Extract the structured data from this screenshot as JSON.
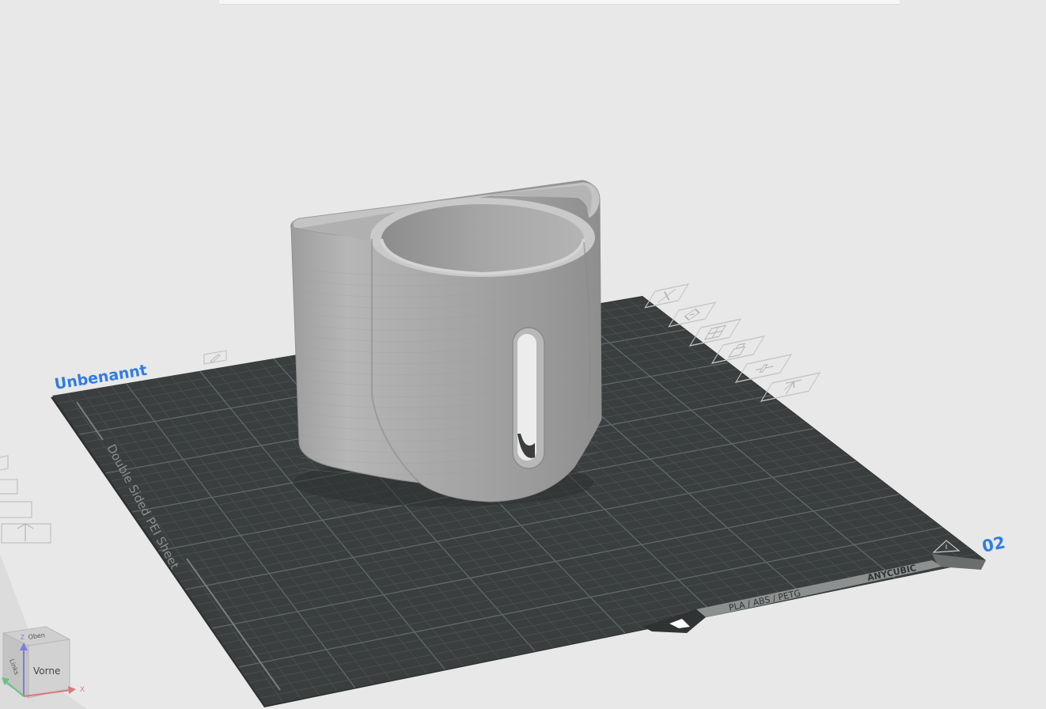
{
  "window": {
    "top_bar": ""
  },
  "plate": {
    "name": "Unbenannt",
    "number": "02",
    "sheet_label": "Double Sided PEI Sheet",
    "material_label": "PLA / ABS / PETG",
    "brand_label": "ANYCUBIC",
    "tools": [
      {
        "name": "delete-plate",
        "icon": "close-icon"
      },
      {
        "name": "auto-orient",
        "icon": "orient-icon"
      },
      {
        "name": "arrange",
        "icon": "arrange-icon"
      },
      {
        "name": "lock-plate",
        "icon": "lock-icon"
      },
      {
        "name": "plate-settings",
        "icon": "settings-icon"
      },
      {
        "name": "move-plate",
        "icon": "move-up-icon"
      }
    ]
  },
  "model": {
    "name": "cup-holder",
    "color": "#a8a8a8"
  },
  "nav_cube": {
    "top_label": "Oben",
    "front_label": "Vorne",
    "left_label": "Links",
    "x_label": "X",
    "z_label": "Z"
  },
  "colors": {
    "accent": "#2f7de1",
    "background": "#e8e8e8",
    "plate": "#3a3e3f",
    "grid": "#565b5c"
  }
}
